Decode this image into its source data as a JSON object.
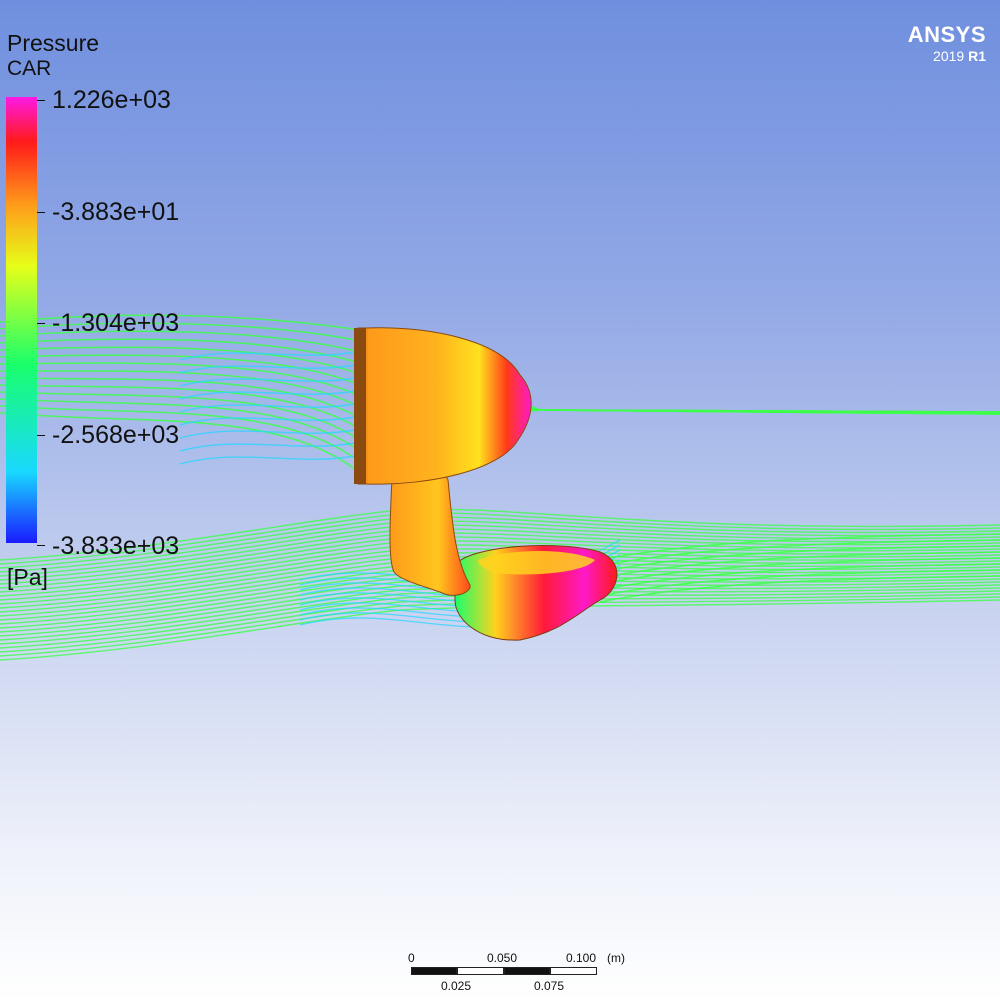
{
  "legend": {
    "title": "Pressure",
    "subtitle": "CAR",
    "ticks": [
      "1.226e+03",
      "-3.883e+01",
      "-1.304e+03",
      "-2.568e+03",
      "-3.833e+03"
    ],
    "unit": "[Pa]"
  },
  "brand": {
    "name": "ANSYS",
    "version_year": "2019",
    "version_release": "R1"
  },
  "scale": {
    "top_labels": [
      "0",
      "0.050",
      "0.100"
    ],
    "unit": "(m)",
    "bottom_labels": [
      "0.025",
      "0.075"
    ]
  },
  "colors": {
    "background_top": "#6f8fde",
    "background_bottom": "#ffffff",
    "colormap": [
      "#1a1aff",
      "#19d9ff",
      "#19ff6b",
      "#e6ff19",
      "#ff9a1a",
      "#ff1a1a",
      "#ff19e6"
    ],
    "streamline_green": "#3dff4a",
    "streamline_cyan": "#2ad6ff",
    "brand_text": "#ffffff"
  }
}
